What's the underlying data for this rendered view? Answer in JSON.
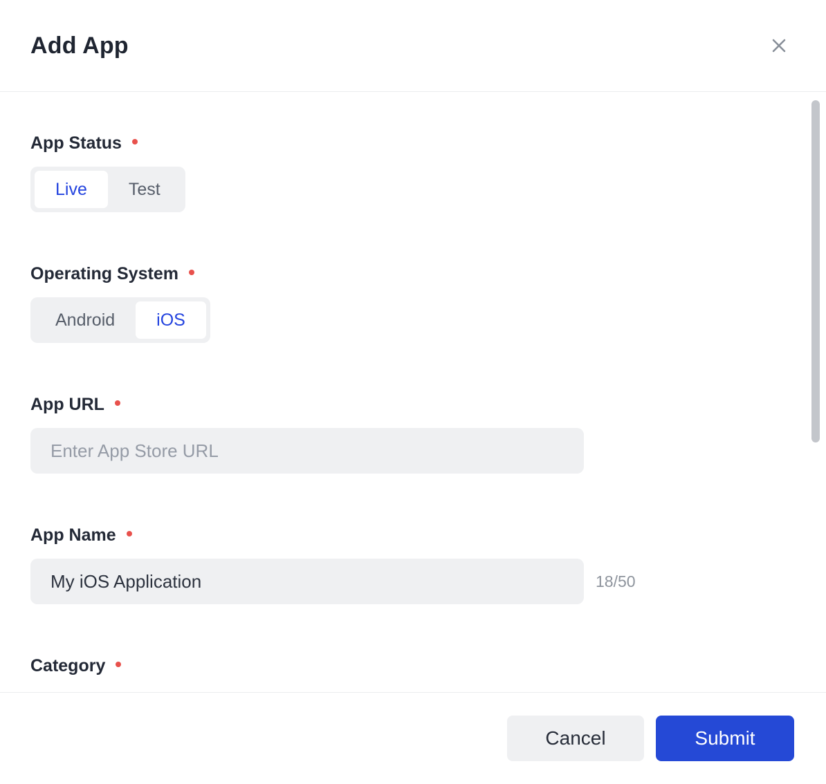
{
  "header": {
    "title": "Add App"
  },
  "form": {
    "app_status": {
      "label": "App Status",
      "required": true,
      "options": [
        "Live",
        "Test"
      ],
      "selected": "Live"
    },
    "operating_system": {
      "label": "Operating System",
      "required": true,
      "options": [
        "Android",
        "iOS"
      ],
      "selected": "iOS"
    },
    "app_url": {
      "label": "App URL",
      "required": true,
      "placeholder": "Enter App Store URL",
      "value": ""
    },
    "app_name": {
      "label": "App Name",
      "required": true,
      "value": "My iOS Application",
      "char_count": "18/50",
      "max_length": 50
    },
    "category": {
      "label": "Category",
      "required": true
    }
  },
  "footer": {
    "cancel_label": "Cancel",
    "submit_label": "Submit"
  },
  "colors": {
    "accent_blue": "#2549d6",
    "selected_text_blue": "#2343df",
    "required_dot_red": "#e8514c",
    "input_background": "#eff0f2"
  }
}
